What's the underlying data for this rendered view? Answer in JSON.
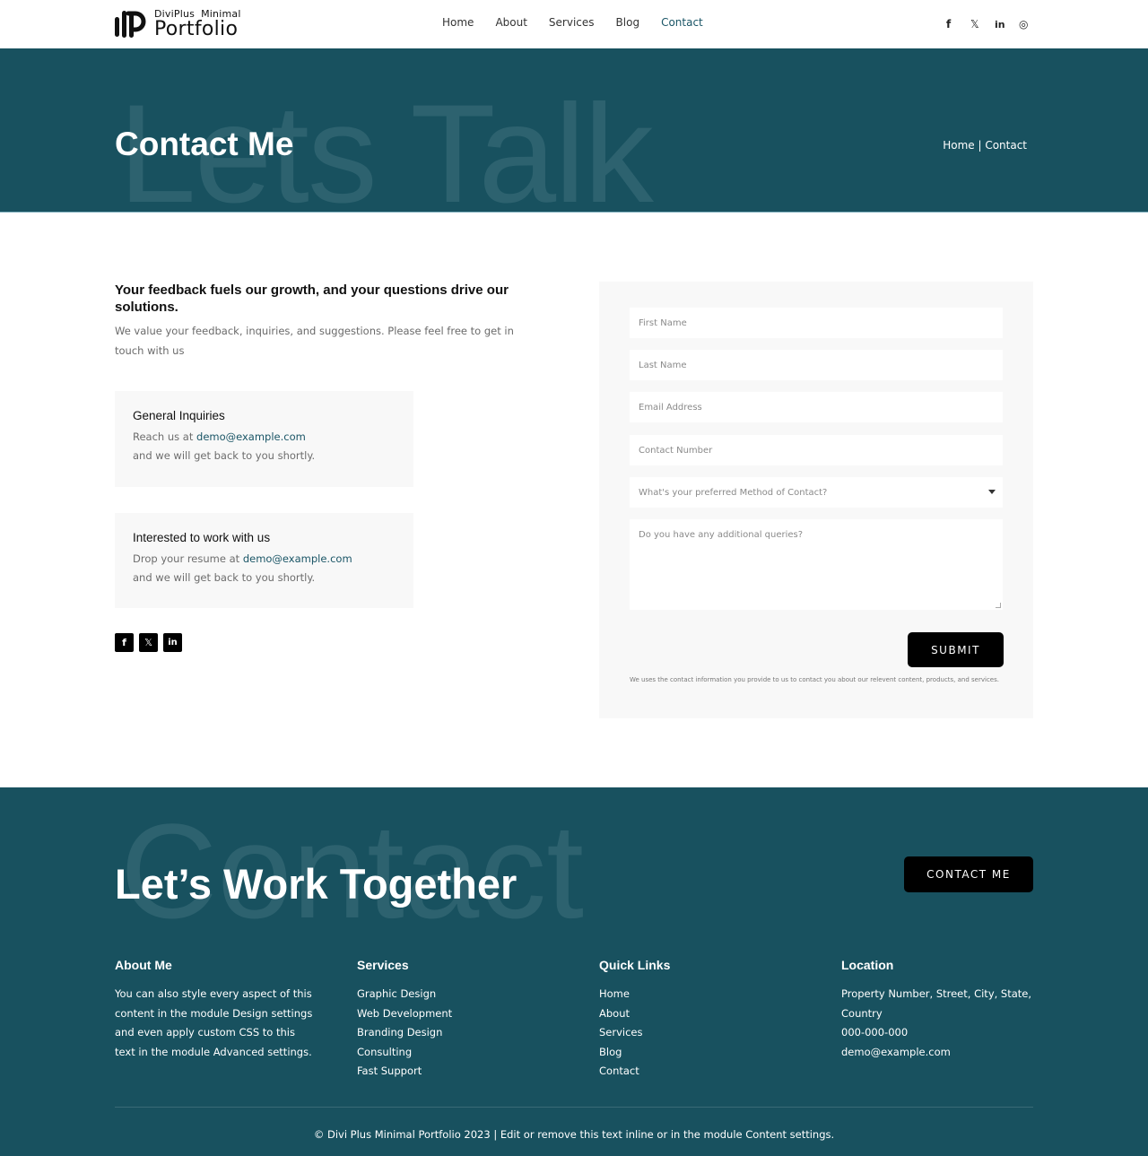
{
  "header": {
    "logo": {
      "top_left": "DiviPlus",
      "top_right": "Minimal",
      "bottom": "Portfolio"
    },
    "nav": [
      {
        "label": "Home",
        "active": false
      },
      {
        "label": "About",
        "active": false
      },
      {
        "label": "Services",
        "active": false
      },
      {
        "label": "Blog",
        "active": false
      },
      {
        "label": "Contact",
        "active": true
      }
    ],
    "social": [
      {
        "icon": "facebook-icon",
        "glyph": "f"
      },
      {
        "icon": "x-twitter-icon",
        "glyph": "𝕏"
      },
      {
        "icon": "linkedin-icon",
        "glyph": "in"
      },
      {
        "icon": "instagram-icon",
        "glyph": "◎"
      }
    ]
  },
  "hero": {
    "background_text": "Lets Talk",
    "title": "Contact Me",
    "breadcrumb": "Home | Contact"
  },
  "intro": {
    "heading": "Your feedback fuels our growth, and your questions drive our solutions.",
    "text": "We value your feedback, inquiries, and suggestions. Please feel free to get in touch with us"
  },
  "cards": [
    {
      "title": "General Inquiries",
      "prefix": "Reach us at ",
      "email": "demo@example.com",
      "suffix": "and we will get back to you shortly."
    },
    {
      "title": "Interested to work with us",
      "prefix": "Drop your resume at ",
      "email": "demo@example.com",
      "suffix": "and we will get back to you shortly."
    }
  ],
  "social_squares": [
    {
      "icon": "facebook-icon",
      "glyph": "f"
    },
    {
      "icon": "x-twitter-icon",
      "glyph": "𝕏"
    },
    {
      "icon": "linkedin-icon",
      "glyph": "in"
    }
  ],
  "form": {
    "first_name": {
      "placeholder": "First Name",
      "value": ""
    },
    "last_name": {
      "placeholder": "Last Name",
      "value": ""
    },
    "email": {
      "placeholder": "Email Address",
      "value": ""
    },
    "phone": {
      "placeholder": "Contact Number",
      "value": ""
    },
    "method": {
      "selected": "What's your preferred Method of Contact?"
    },
    "queries": {
      "placeholder": "Do you have any additional queries?",
      "value": ""
    },
    "submit_label": "SUBMIT",
    "disclaimer": "We uses the contact information you provide to us to contact you about our relevent content, products, and services."
  },
  "footer": {
    "background_text": "Contact",
    "title": "Let’s Work Together",
    "cta_label": "CONTACT ME",
    "about": {
      "heading": "About Me",
      "lines": [
        "You can also style every aspect of this",
        "content in the module Design settings",
        "and even apply custom CSS to this",
        "text in the module Advanced settings."
      ]
    },
    "services": {
      "heading": "Services",
      "items": [
        "Graphic Design",
        "Web Development",
        "Branding Design",
        "Consulting",
        "Fast Support"
      ]
    },
    "quick_links": {
      "heading": "Quick Links",
      "items": [
        "Home",
        "About",
        "Services",
        "Blog",
        "Contact"
      ]
    },
    "location": {
      "heading": "Location",
      "lines": [
        "Property Number, Street, City, State,",
        "Country",
        "000-000-000",
        "demo@example.com"
      ]
    },
    "copyright": "© Divi Plus Minimal Portfolio 2023 | Edit or remove this text inline or in the module Content settings."
  },
  "colors": {
    "brand_teal": "#18515f",
    "accent_link": "#1a5566",
    "button_black": "#000000",
    "card_bg": "#f8f8f8"
  }
}
